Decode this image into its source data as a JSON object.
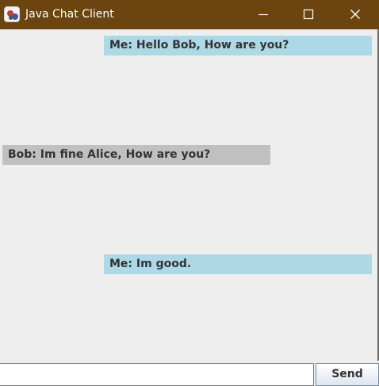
{
  "window": {
    "title": "Java Chat Client",
    "titlebar_color": "#6b4410",
    "app_icon": "java-chat-app-icon",
    "controls": {
      "minimize_icon": "minimize-icon",
      "maximize_icon": "maximize-icon",
      "close_icon": "close-icon"
    }
  },
  "chat": {
    "background_color": "#eeeeee",
    "outgoing_color": "#add8e6",
    "incoming_color": "#c0c0c0",
    "messages": [
      {
        "direction": "outgoing",
        "text": "Me: Hello Bob, How are you?"
      },
      {
        "direction": "incoming",
        "text": "Bob: Im fine Alice, How are you?"
      },
      {
        "direction": "outgoing",
        "text": "Me: Im good."
      }
    ]
  },
  "composer": {
    "input_value": "",
    "input_placeholder": "",
    "send_label": "Send"
  }
}
